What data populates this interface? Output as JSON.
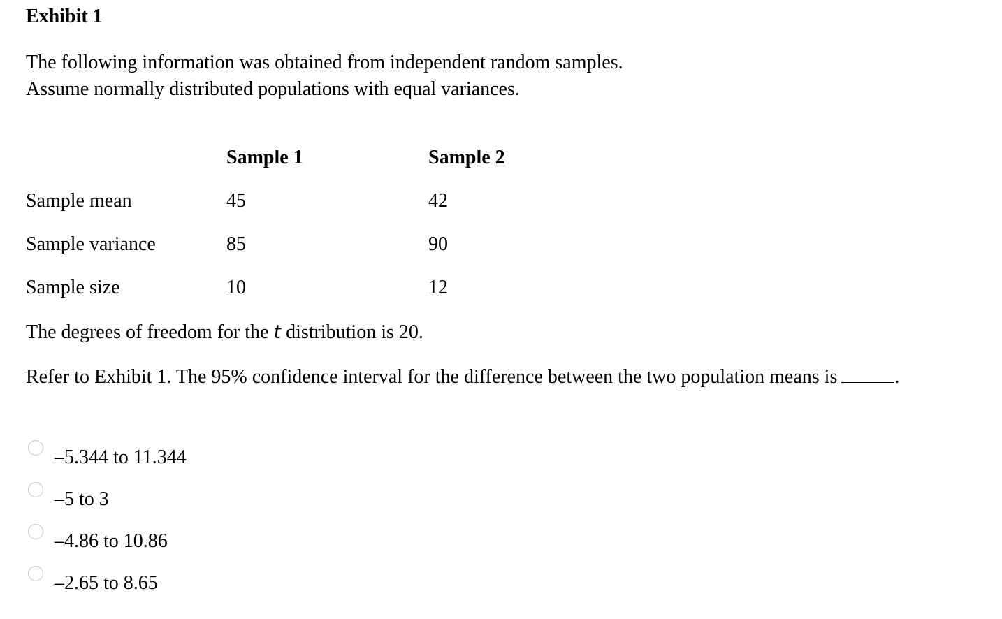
{
  "exhibit": {
    "title": "Exhibit 1",
    "intro_line1": "The following information was obtained from independent random samples.",
    "intro_line2": "Assume normally distributed populations with equal variances."
  },
  "table": {
    "columns": [
      "Sample 1",
      "Sample 2"
    ],
    "rows": [
      {
        "label": "Sample mean",
        "values": [
          "45",
          "42"
        ]
      },
      {
        "label": "Sample variance",
        "values": [
          "85",
          "90"
        ]
      },
      {
        "label": "Sample size",
        "values": [
          "10",
          "12"
        ]
      }
    ]
  },
  "degrees_of_freedom": {
    "prefix": "The degrees of freedom for the ",
    "variable": "t",
    "suffix": " distribution is 20."
  },
  "question": {
    "text": "Refer to Exhibit 1. The 95% confidence interval for the difference between the two population means is",
    "end": "."
  },
  "options": [
    {
      "label": "–5.344 to 11.344",
      "selected": false
    },
    {
      "label": "–5 to 3",
      "selected": false
    },
    {
      "label": "–4.86 to 10.86",
      "selected": false
    },
    {
      "label": "–2.65 to 8.65",
      "selected": false
    }
  ]
}
